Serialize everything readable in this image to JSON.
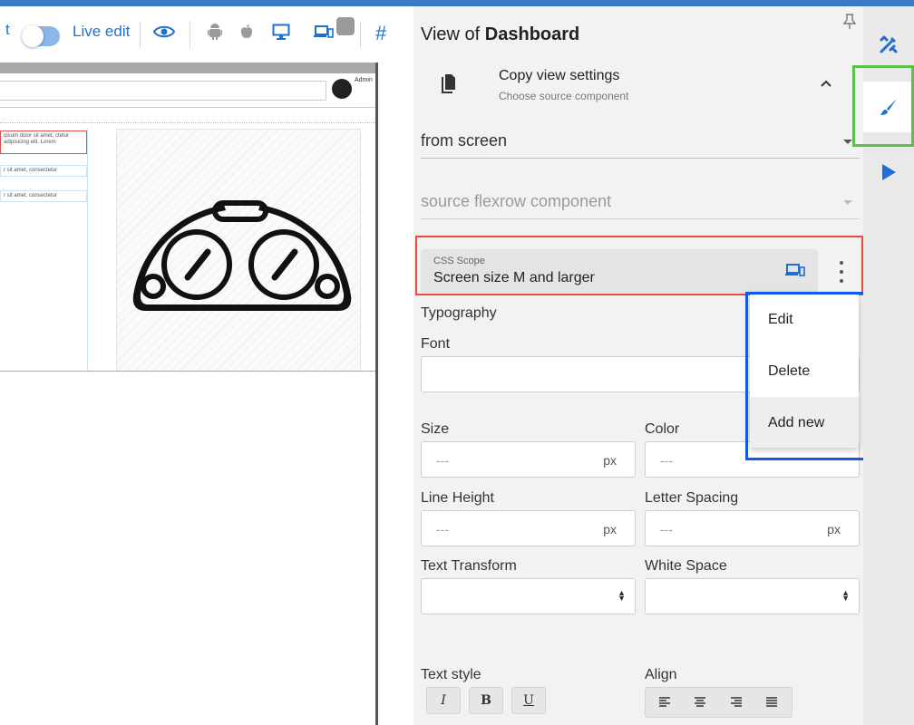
{
  "toolbar": {
    "partial_label": "t",
    "live_edit_label": "Live edit",
    "badge_count": "",
    "hash_symbol": "#",
    "accent_color": "#1f6fd1"
  },
  "preview": {
    "admin_label": "Admin",
    "snippets": [
      "ipsum dolor sit amet, ctetur adipisicing elit. Lorem",
      "r sit amet, consectetur",
      "r sit amet, consectetur"
    ],
    "image_icon": "dashboard-gauge-icon"
  },
  "panel": {
    "title_prefix": "View of",
    "title_bold": "Dashboard",
    "copy": {
      "title": "Copy view settings",
      "subtitle": "Choose source component"
    },
    "from_select": {
      "value": "from screen"
    },
    "source_select": {
      "placeholder": "source flexrow component"
    },
    "css_scope": {
      "label": "CSS Scope",
      "value": "Screen size M and larger"
    },
    "typography_label": "Typography",
    "font_label": "Font",
    "size_label": "Size",
    "size_value": "---",
    "size_unit": "px",
    "color_label": "Color",
    "color_value": "---",
    "line_height_label": "Line Height",
    "line_height_value": "---",
    "line_height_unit": "px",
    "letter_spacing_label": "Letter Spacing",
    "letter_spacing_value": "---",
    "letter_spacing_unit": "px",
    "text_transform_label": "Text Transform",
    "white_space_label": "White Space",
    "text_style_label": "Text style",
    "align_label": "Align",
    "style_buttons": [
      "I",
      "B",
      "U"
    ]
  },
  "menu": {
    "items": [
      "Edit",
      "Delete",
      "Add new"
    ],
    "hovered_index": 2
  },
  "rail": {
    "items": [
      "design-tools-icon",
      "brush-icon",
      "play-icon"
    ],
    "active_index": 1
  },
  "highlight_colors": {
    "red": "#f04a3a",
    "blue": "#1458e8",
    "green": "#5ec04a"
  }
}
